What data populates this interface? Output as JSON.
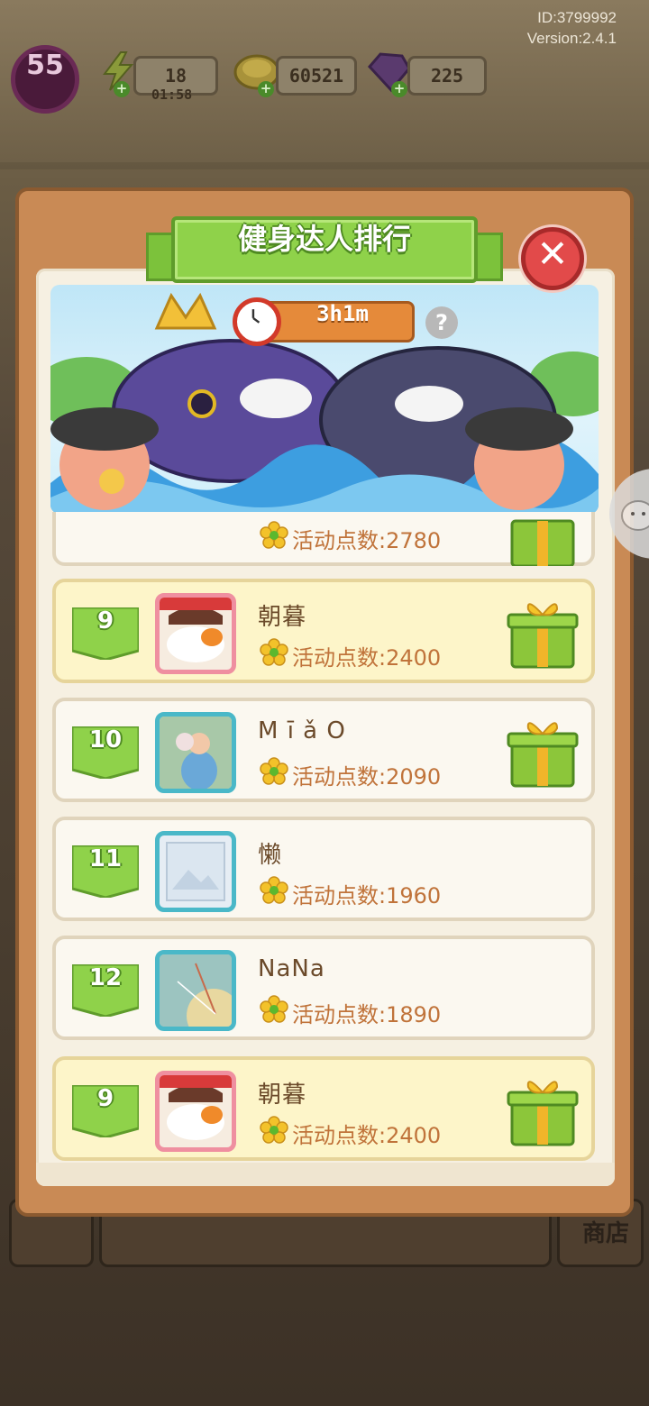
{
  "header": {
    "id_text": "ID:3799992",
    "version_text": "Version:2.4.1"
  },
  "hud": {
    "level": "55",
    "energy": "18",
    "energy_timer": "01:58",
    "coins": "60521",
    "gems": "225"
  },
  "panel": {
    "title": "健身达人排行",
    "timer": "3h1m",
    "help": "?",
    "close": "✕"
  },
  "list": {
    "partial_row": {
      "score": "活动点数:2780"
    },
    "rows": [
      {
        "rank": "9",
        "name": "朝暮",
        "score": "活动点数:2400",
        "highlight": true,
        "gift": true,
        "avatar": "pink"
      },
      {
        "rank": "10",
        "name": "M ī ǎ O",
        "score": "活动点数:2090",
        "highlight": false,
        "gift": true,
        "avatar": "cyan"
      },
      {
        "rank": "11",
        "name": "懒",
        "score": "活动点数:1960",
        "highlight": false,
        "gift": false,
        "avatar": "cyan"
      },
      {
        "rank": "12",
        "name": "NaNa",
        "score": "活动点数:1890",
        "highlight": false,
        "gift": false,
        "avatar": "cyan"
      }
    ],
    "self_row": {
      "rank": "9",
      "name": "朝暮",
      "score": "活动点数:2400"
    }
  },
  "bottom": {
    "shop_label": "商店"
  },
  "colors": {
    "accent_green": "#8fd24a",
    "panel_brown": "#c98a55",
    "score_orange": "#c0733a",
    "close_red": "#e24a4a"
  }
}
